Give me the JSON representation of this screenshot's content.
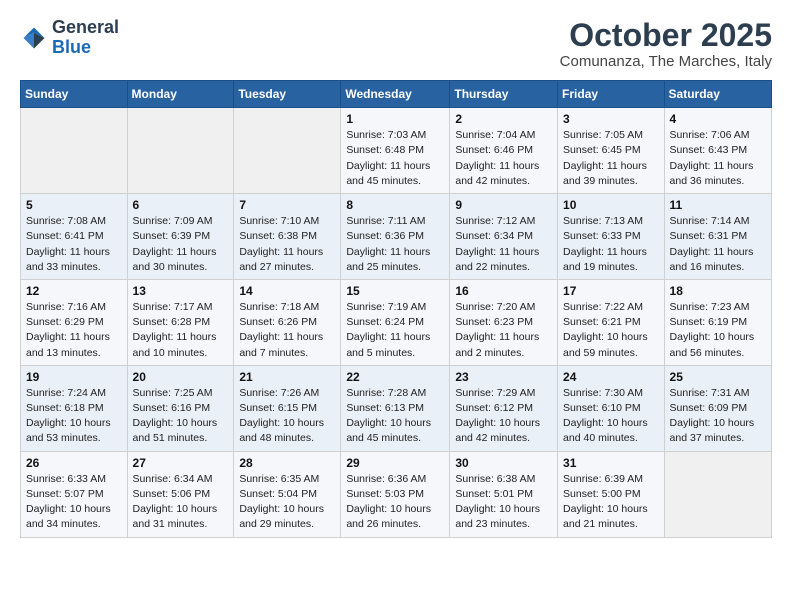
{
  "header": {
    "logo_general": "General",
    "logo_blue": "Blue",
    "title": "October 2025",
    "subtitle": "Comunanza, The Marches, Italy"
  },
  "weekdays": [
    "Sunday",
    "Monday",
    "Tuesday",
    "Wednesday",
    "Thursday",
    "Friday",
    "Saturday"
  ],
  "weeks": [
    [
      {
        "day": "",
        "info": ""
      },
      {
        "day": "",
        "info": ""
      },
      {
        "day": "",
        "info": ""
      },
      {
        "day": "1",
        "info": "Sunrise: 7:03 AM\nSunset: 6:48 PM\nDaylight: 11 hours and 45 minutes."
      },
      {
        "day": "2",
        "info": "Sunrise: 7:04 AM\nSunset: 6:46 PM\nDaylight: 11 hours and 42 minutes."
      },
      {
        "day": "3",
        "info": "Sunrise: 7:05 AM\nSunset: 6:45 PM\nDaylight: 11 hours and 39 minutes."
      },
      {
        "day": "4",
        "info": "Sunrise: 7:06 AM\nSunset: 6:43 PM\nDaylight: 11 hours and 36 minutes."
      }
    ],
    [
      {
        "day": "5",
        "info": "Sunrise: 7:08 AM\nSunset: 6:41 PM\nDaylight: 11 hours and 33 minutes."
      },
      {
        "day": "6",
        "info": "Sunrise: 7:09 AM\nSunset: 6:39 PM\nDaylight: 11 hours and 30 minutes."
      },
      {
        "day": "7",
        "info": "Sunrise: 7:10 AM\nSunset: 6:38 PM\nDaylight: 11 hours and 27 minutes."
      },
      {
        "day": "8",
        "info": "Sunrise: 7:11 AM\nSunset: 6:36 PM\nDaylight: 11 hours and 25 minutes."
      },
      {
        "day": "9",
        "info": "Sunrise: 7:12 AM\nSunset: 6:34 PM\nDaylight: 11 hours and 22 minutes."
      },
      {
        "day": "10",
        "info": "Sunrise: 7:13 AM\nSunset: 6:33 PM\nDaylight: 11 hours and 19 minutes."
      },
      {
        "day": "11",
        "info": "Sunrise: 7:14 AM\nSunset: 6:31 PM\nDaylight: 11 hours and 16 minutes."
      }
    ],
    [
      {
        "day": "12",
        "info": "Sunrise: 7:16 AM\nSunset: 6:29 PM\nDaylight: 11 hours and 13 minutes."
      },
      {
        "day": "13",
        "info": "Sunrise: 7:17 AM\nSunset: 6:28 PM\nDaylight: 11 hours and 10 minutes."
      },
      {
        "day": "14",
        "info": "Sunrise: 7:18 AM\nSunset: 6:26 PM\nDaylight: 11 hours and 7 minutes."
      },
      {
        "day": "15",
        "info": "Sunrise: 7:19 AM\nSunset: 6:24 PM\nDaylight: 11 hours and 5 minutes."
      },
      {
        "day": "16",
        "info": "Sunrise: 7:20 AM\nSunset: 6:23 PM\nDaylight: 11 hours and 2 minutes."
      },
      {
        "day": "17",
        "info": "Sunrise: 7:22 AM\nSunset: 6:21 PM\nDaylight: 10 hours and 59 minutes."
      },
      {
        "day": "18",
        "info": "Sunrise: 7:23 AM\nSunset: 6:19 PM\nDaylight: 10 hours and 56 minutes."
      }
    ],
    [
      {
        "day": "19",
        "info": "Sunrise: 7:24 AM\nSunset: 6:18 PM\nDaylight: 10 hours and 53 minutes."
      },
      {
        "day": "20",
        "info": "Sunrise: 7:25 AM\nSunset: 6:16 PM\nDaylight: 10 hours and 51 minutes."
      },
      {
        "day": "21",
        "info": "Sunrise: 7:26 AM\nSunset: 6:15 PM\nDaylight: 10 hours and 48 minutes."
      },
      {
        "day": "22",
        "info": "Sunrise: 7:28 AM\nSunset: 6:13 PM\nDaylight: 10 hours and 45 minutes."
      },
      {
        "day": "23",
        "info": "Sunrise: 7:29 AM\nSunset: 6:12 PM\nDaylight: 10 hours and 42 minutes."
      },
      {
        "day": "24",
        "info": "Sunrise: 7:30 AM\nSunset: 6:10 PM\nDaylight: 10 hours and 40 minutes."
      },
      {
        "day": "25",
        "info": "Sunrise: 7:31 AM\nSunset: 6:09 PM\nDaylight: 10 hours and 37 minutes."
      }
    ],
    [
      {
        "day": "26",
        "info": "Sunrise: 6:33 AM\nSunset: 5:07 PM\nDaylight: 10 hours and 34 minutes."
      },
      {
        "day": "27",
        "info": "Sunrise: 6:34 AM\nSunset: 5:06 PM\nDaylight: 10 hours and 31 minutes."
      },
      {
        "day": "28",
        "info": "Sunrise: 6:35 AM\nSunset: 5:04 PM\nDaylight: 10 hours and 29 minutes."
      },
      {
        "day": "29",
        "info": "Sunrise: 6:36 AM\nSunset: 5:03 PM\nDaylight: 10 hours and 26 minutes."
      },
      {
        "day": "30",
        "info": "Sunrise: 6:38 AM\nSunset: 5:01 PM\nDaylight: 10 hours and 23 minutes."
      },
      {
        "day": "31",
        "info": "Sunrise: 6:39 AM\nSunset: 5:00 PM\nDaylight: 10 hours and 21 minutes."
      },
      {
        "day": "",
        "info": ""
      }
    ]
  ]
}
